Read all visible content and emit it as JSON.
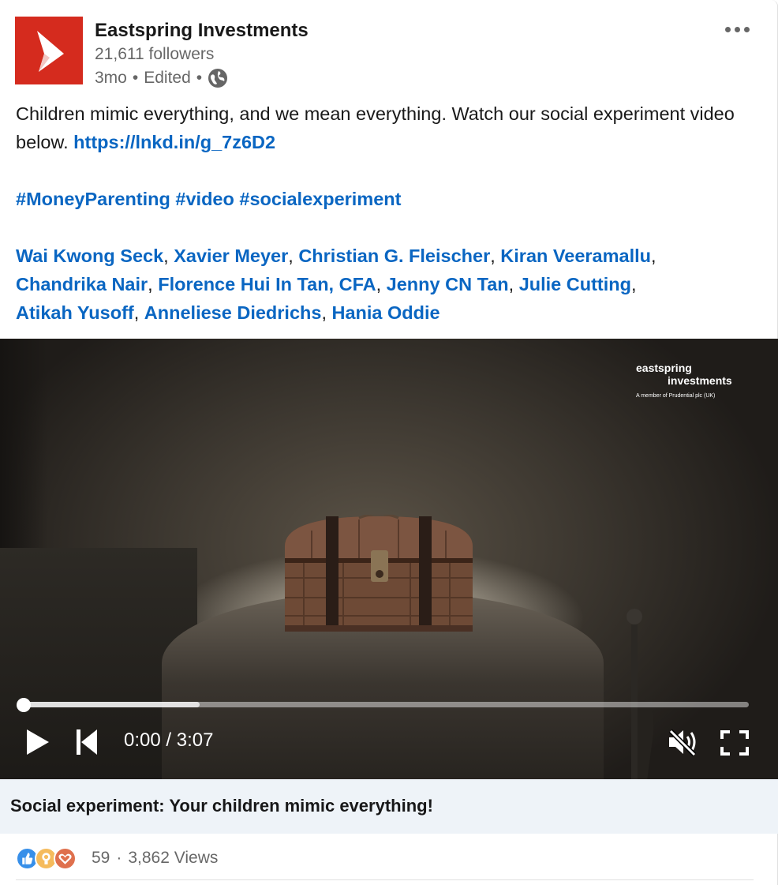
{
  "post": {
    "company": "Eastspring Investments",
    "followers": "21,611 followers",
    "time": "3mo",
    "edited": "Edited",
    "sep": "•",
    "icons": {
      "logo": "eastspring-logo-icon",
      "visibility": "globe-icon",
      "more": "more-options-icon"
    },
    "text_line1": "Children mimic everything, and we mean everything. Watch our social experiment video below. ",
    "link": "https://lnkd.in/g_7z6D2",
    "hashtags": [
      "#MoneyParenting",
      "#video",
      "#socialexperiment"
    ],
    "mentions": [
      "Wai Kwong Seck",
      "Xavier Meyer",
      "Christian G. Fleischer",
      "Kiran Veeramallu",
      "Chandrika Nair",
      "Florence Hui In Tan, CFA",
      "Jenny CN Tan",
      "Julie Cutting",
      "Atikah Yusoff",
      "Anneliese Diedrichs",
      "Hania Oddie"
    ],
    "mention_sep": ","
  },
  "video": {
    "brand_line1": "eastspring",
    "brand_line2": "investments",
    "brand_tagline": "A member of Prudential plc (UK)",
    "time_display": "0:00 / 3:07",
    "played_fraction": 0,
    "buffered_fraction": 0.243,
    "icons": {
      "play": "play-icon",
      "restart": "skip-back-icon",
      "mute": "muted-speaker-icon",
      "fullscreen": "fullscreen-icon"
    },
    "title": "Social experiment: Your children mimic everything!"
  },
  "social": {
    "reaction_icons": [
      "like-icon",
      "insightful-icon",
      "love-icon"
    ],
    "reactions": "59",
    "dot": "·",
    "views": "3,862 Views"
  },
  "colors": {
    "link": "#0a66c2",
    "brand_red": "#d52b1e",
    "title_bar": "#eef3f8"
  }
}
